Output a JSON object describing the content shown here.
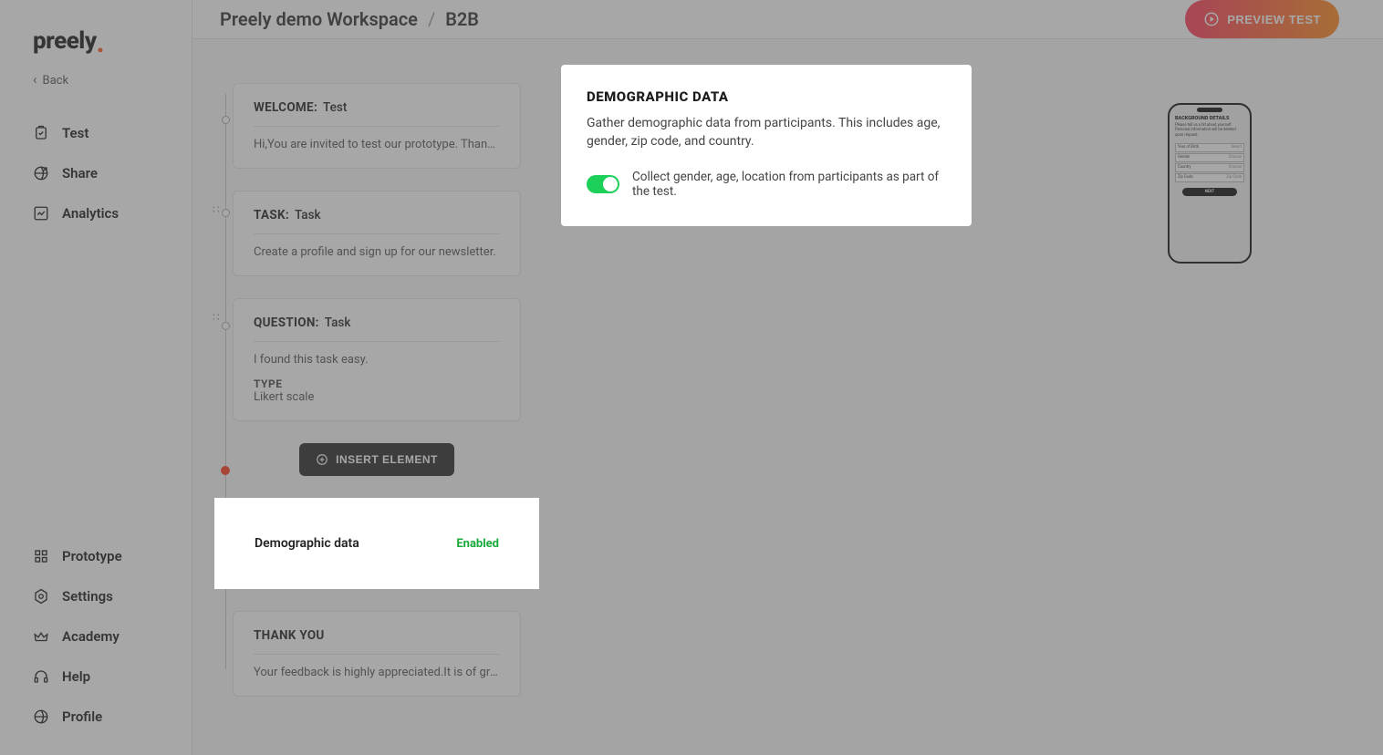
{
  "brand": "preely",
  "back": "Back",
  "nav": {
    "test": "Test",
    "share": "Share",
    "analytics": "Analytics",
    "prototype": "Prototype",
    "settings": "Settings",
    "academy": "Academy",
    "help": "Help",
    "profile": "Profile"
  },
  "breadcrumb": {
    "workspace": "Preely demo Workspace",
    "sep": "/",
    "project": "B2B"
  },
  "preview_button": "PREVIEW TEST",
  "cards": {
    "welcome": {
      "label": "WELCOME:",
      "value": "Test",
      "body": "Hi,You are invited to test our prototype. Thank …"
    },
    "task": {
      "label": "TASK:",
      "value": "Task",
      "body": "Create a profile and sign up for our newsletter."
    },
    "question": {
      "label": "QUESTION:",
      "value": "Task",
      "body": "I found this task easy.",
      "type_label": "TYPE",
      "type_value": "Likert scale"
    },
    "insert": "INSERT ELEMENT",
    "demo": {
      "name": "Demographic data",
      "status": "Enabled"
    },
    "thankyou": {
      "label": "THANK YOU",
      "body": "Your feedback is highly appreciated.It is of gre…"
    }
  },
  "detail": {
    "heading": "DEMOGRAPHIC DATA",
    "description": "Gather demographic data from participants. This includes age, gender, zip code, and country.",
    "toggle_label": "Collect gender, age, location from participants as part of the test."
  },
  "phone": {
    "title": "BACKGROUND DETAILS",
    "para": "Please tell us a bit about yourself. Personal information will be deleted upon request.",
    "fields": {
      "yob": {
        "label": "Year of Birth",
        "placeholder": "Select"
      },
      "gender": {
        "label": "Gender",
        "placeholder": "Choose"
      },
      "country": {
        "label": "Country",
        "placeholder": "Choose"
      },
      "zip": {
        "label": "Zip Code",
        "placeholder": "Zip Code"
      }
    },
    "next": "NEXT"
  }
}
